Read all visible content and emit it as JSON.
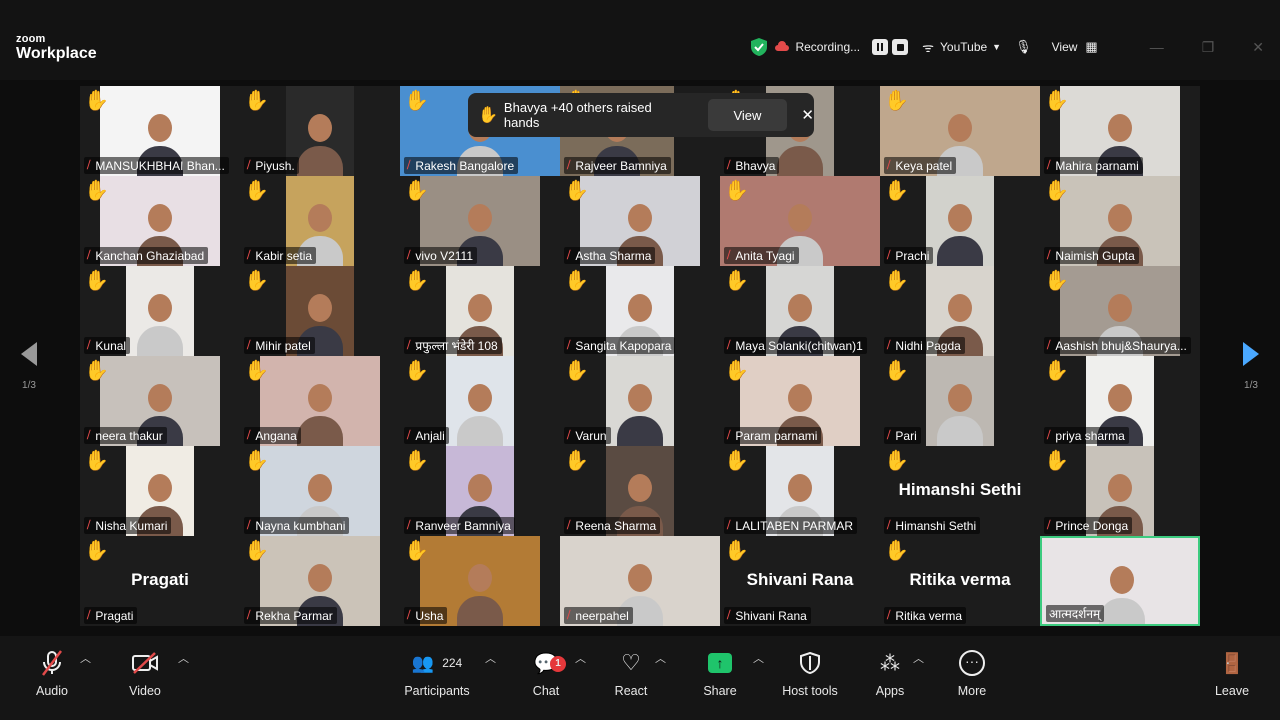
{
  "app": {
    "logo_top": "zoom",
    "logo_bottom": "Workplace"
  },
  "titlebar": {
    "recording_label": "Recording...",
    "stream_label": "YouTube",
    "view_label": "View",
    "window_controls": [
      "—",
      "❐",
      "✕"
    ]
  },
  "notification": {
    "text": "Bhavya +40 others raised hands",
    "view_label": "View",
    "close_label": "✕"
  },
  "pagination": {
    "left": "1/3",
    "right": "1/3"
  },
  "participants": [
    {
      "name": "MANSUKHBHAI Bhan...",
      "hand": true,
      "muted": true,
      "bg": "#f4f4f4",
      "vx": 20,
      "vw": 120
    },
    {
      "name": "Piyush.",
      "hand": true,
      "muted": true,
      "bg": "#2a2a2a",
      "vx": 46,
      "vw": 68
    },
    {
      "name": "Rakesh  Bangalore",
      "hand": true,
      "muted": true,
      "bg": "#4a8fd0",
      "vx": 0,
      "vw": 160
    },
    {
      "name": "Rajveer Bamniya",
      "hand": true,
      "muted": true,
      "bg": "#7b6c5a",
      "vx": 0,
      "vw": 114
    },
    {
      "name": "Bhavya",
      "hand": true,
      "muted": true,
      "bg": "#9f978c",
      "vx": 46,
      "vw": 68
    },
    {
      "name": "Keya patel",
      "hand": true,
      "muted": true,
      "bg": "#bfa78d",
      "vx": 0,
      "vw": 160
    },
    {
      "name": "Mahira parnami",
      "hand": true,
      "muted": true,
      "bg": "#dcdad6",
      "vx": 20,
      "vw": 120
    },
    {
      "name": "Kanchan Ghaziabad",
      "hand": true,
      "muted": true,
      "bg": "#e8dfe4",
      "vx": 20,
      "vw": 120
    },
    {
      "name": "Kabir setia",
      "hand": true,
      "muted": true,
      "bg": "#c6a35d",
      "vx": 46,
      "vw": 68
    },
    {
      "name": "vivo V2111",
      "hand": true,
      "muted": true,
      "bg": "#9a8f84",
      "vx": 20,
      "vw": 120
    },
    {
      "name": "Astha Sharma",
      "hand": true,
      "muted": true,
      "bg": "#d1d1d6",
      "vx": 20,
      "vw": 120
    },
    {
      "name": "Anita Tyagi",
      "hand": true,
      "muted": true,
      "bg": "#b07a70",
      "vx": 0,
      "vw": 160
    },
    {
      "name": "Prachi",
      "hand": true,
      "muted": true,
      "bg": "#d2d2cc",
      "vx": 46,
      "vw": 68
    },
    {
      "name": "Naimish Gupta",
      "hand": true,
      "muted": true,
      "bg": "#c9c3b9",
      "vx": 20,
      "vw": 120
    },
    {
      "name": "Kunal",
      "hand": true,
      "muted": true,
      "bg": "#ebe9e6",
      "vx": 46,
      "vw": 68
    },
    {
      "name": "Mihir patel",
      "hand": true,
      "muted": true,
      "bg": "#6b4b36",
      "vx": 46,
      "vw": 68
    },
    {
      "name": "प्रफुल्ला भंडेरी 108",
      "hand": true,
      "muted": true,
      "bg": "#e5e3dd",
      "vx": 46,
      "vw": 68
    },
    {
      "name": "Sangita Kapopara",
      "hand": true,
      "muted": true,
      "bg": "#e9e9eb",
      "vx": 46,
      "vw": 68
    },
    {
      "name": "Maya Solanki(chitwan)1",
      "hand": true,
      "muted": true,
      "bg": "#d6d6d4",
      "vx": 46,
      "vw": 68
    },
    {
      "name": "Nidhi Pagda",
      "hand": true,
      "muted": true,
      "bg": "#d8d4cd",
      "vx": 46,
      "vw": 68
    },
    {
      "name": "Aashish bhuj&Shaurya...",
      "hand": true,
      "muted": true,
      "bg": "#a49b92",
      "vx": 20,
      "vw": 120
    },
    {
      "name": "neera thakur",
      "hand": true,
      "muted": true,
      "bg": "#c7c1bb",
      "vx": 20,
      "vw": 120
    },
    {
      "name": "Angana",
      "hand": true,
      "muted": true,
      "bg": "#d2b4ad",
      "vx": 20,
      "vw": 120
    },
    {
      "name": "Anjali",
      "hand": true,
      "muted": true,
      "bg": "#dfe4ea",
      "vx": 46,
      "vw": 68
    },
    {
      "name": "Varun",
      "hand": true,
      "muted": true,
      "bg": "#d9d8d4",
      "vx": 46,
      "vw": 68
    },
    {
      "name": "Param parnami",
      "hand": true,
      "muted": true,
      "bg": "#e0cfc5",
      "vx": 20,
      "vw": 120
    },
    {
      "name": "Pari",
      "hand": true,
      "muted": true,
      "bg": "#bdb8b2",
      "vx": 46,
      "vw": 68
    },
    {
      "name": "priya sharma",
      "hand": true,
      "muted": true,
      "bg": "#efefed",
      "vx": 46,
      "vw": 68
    },
    {
      "name": "Nisha Kumari",
      "hand": true,
      "muted": true,
      "bg": "#f0ece4",
      "vx": 46,
      "vw": 68
    },
    {
      "name": "Nayna kumbhani",
      "hand": true,
      "muted": true,
      "bg": "#cfd6de",
      "vx": 20,
      "vw": 120
    },
    {
      "name": "Ranveer Bamniya",
      "hand": true,
      "muted": true,
      "bg": "#c7b8d7",
      "vx": 46,
      "vw": 68
    },
    {
      "name": "Reena Sharma",
      "hand": true,
      "muted": true,
      "bg": "#5a4b42",
      "vx": 46,
      "vw": 68
    },
    {
      "name": "LALITABEN PARMAR",
      "hand": true,
      "muted": true,
      "bg": "#e3e5e8",
      "vx": 46,
      "vw": 68
    },
    {
      "name": "Himanshi Sethi",
      "hand": true,
      "muted": true,
      "bg": "",
      "big": "Himanshi Sethi",
      "vx": 0,
      "vw": 0
    },
    {
      "name": "Prince Donga",
      "hand": true,
      "muted": true,
      "bg": "#c8c2ba",
      "vx": 46,
      "vw": 68
    },
    {
      "name": "Pragati",
      "hand": true,
      "muted": true,
      "bg": "",
      "big": "Pragati",
      "vx": 0,
      "vw": 0
    },
    {
      "name": "Rekha Parmar",
      "hand": true,
      "muted": true,
      "bg": "#cbc3b8",
      "vx": 20,
      "vw": 120
    },
    {
      "name": "Usha",
      "hand": true,
      "muted": true,
      "bg": "#b37b35",
      "vx": 20,
      "vw": 120
    },
    {
      "name": "neerpahel",
      "hand": false,
      "muted": true,
      "bg": "#d9d3cc",
      "vx": 0,
      "vw": 160
    },
    {
      "name": "Shivani Rana",
      "hand": true,
      "muted": true,
      "bg": "",
      "big": "Shivani Rana",
      "vx": 0,
      "vw": 0
    },
    {
      "name": "Ritika verma",
      "hand": true,
      "muted": true,
      "bg": "",
      "big": "Ritika verma",
      "vx": 0,
      "vw": 0
    },
    {
      "name": "आत्मदर्शनम्",
      "hand": false,
      "muted": false,
      "bg": "#e8e4e6",
      "vx": 0,
      "vw": 160,
      "active": true
    }
  ],
  "toolbar": {
    "audio_label": "Audio",
    "video_label": "Video",
    "participants_label": "Participants",
    "participants_count": "224",
    "chat_label": "Chat",
    "chat_badge": "1",
    "react_label": "React",
    "share_label": "Share",
    "host_tools_label": "Host tools",
    "apps_label": "Apps",
    "more_label": "More",
    "leave_label": "Leave"
  },
  "colors": {
    "background": "#0d0d0d",
    "toolbar": "#151515",
    "share_green": "#1fc46b",
    "muted_red": "#e24a4a",
    "active_speaker": "#3ccb7f",
    "hand_yellow": "#f5b81c",
    "pager_blue": "#4aa8ff"
  }
}
